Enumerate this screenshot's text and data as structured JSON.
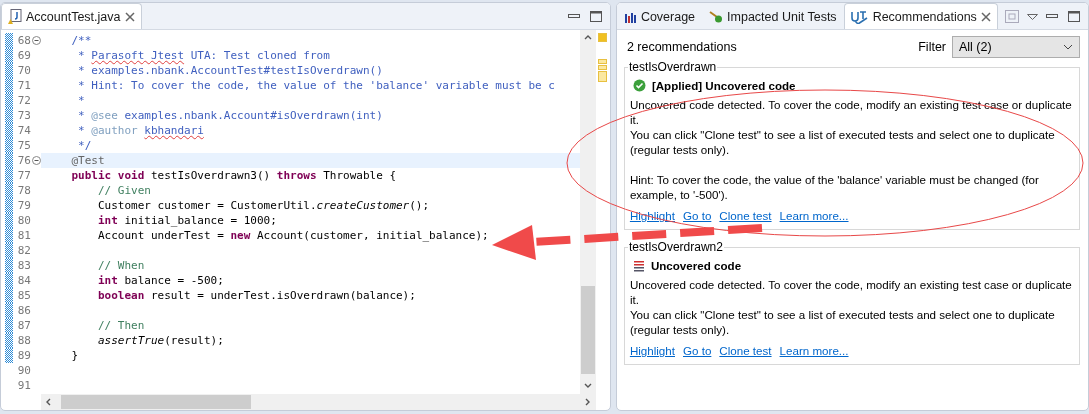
{
  "editor": {
    "tab": {
      "label": "AccountTest.java",
      "selected": true
    },
    "lines": [
      {
        "number": "68",
        "folding": true,
        "highlighted": false,
        "changed": true,
        "tokens": [
          {
            "kind": "javadoc",
            "text": "    /**"
          }
        ]
      },
      {
        "number": "69",
        "folding": false,
        "highlighted": false,
        "changed": true,
        "tokens": [
          {
            "kind": "javadoc",
            "text": "     * "
          },
          {
            "kind": "spelling",
            "text": "Parasoft Jtest"
          },
          {
            "kind": "javadoc",
            "text": " UTA: Test cloned from"
          }
        ]
      },
      {
        "number": "70",
        "folding": false,
        "highlighted": false,
        "changed": true,
        "tokens": [
          {
            "kind": "javadoc",
            "text": "     * examples.nbank.AccountTest#testIsOverdrawn()"
          }
        ]
      },
      {
        "number": "71",
        "folding": false,
        "highlighted": false,
        "changed": true,
        "tokens": [
          {
            "kind": "javadoc",
            "text": "     * Hint: To cover the code, the value of the 'balance' variable must be c"
          }
        ]
      },
      {
        "number": "72",
        "folding": false,
        "highlighted": false,
        "changed": true,
        "tokens": [
          {
            "kind": "javadoc",
            "text": "     *"
          }
        ]
      },
      {
        "number": "73",
        "folding": false,
        "highlighted": false,
        "changed": true,
        "tokens": [
          {
            "kind": "javadoc",
            "text": "     * "
          },
          {
            "kind": "tag",
            "text": "@see"
          },
          {
            "kind": "javadoc",
            "text": " examples.nbank.Account#isOverdrawn(int)"
          }
        ]
      },
      {
        "number": "74",
        "folding": false,
        "highlighted": false,
        "changed": true,
        "tokens": [
          {
            "kind": "javadoc",
            "text": "     * "
          },
          {
            "kind": "tag",
            "text": "@author "
          },
          {
            "kind": "spelling",
            "text": "kbhandari"
          }
        ]
      },
      {
        "number": "75",
        "folding": false,
        "highlighted": false,
        "changed": true,
        "tokens": [
          {
            "kind": "javadoc",
            "text": "     */"
          }
        ]
      },
      {
        "number": "76",
        "folding": true,
        "highlighted": true,
        "changed": true,
        "tokens": [
          {
            "kind": "annotation",
            "text": "    @Test"
          }
        ]
      },
      {
        "number": "77",
        "folding": false,
        "highlighted": false,
        "changed": true,
        "tokens": [
          {
            "kind": "keyword",
            "text": "    public void"
          },
          {
            "kind": "plain",
            "text": " testIsOverdrawn3() "
          },
          {
            "kind": "keyword",
            "text": "throws"
          },
          {
            "kind": "plain",
            "text": " Throwable {"
          }
        ]
      },
      {
        "number": "78",
        "folding": false,
        "highlighted": false,
        "changed": true,
        "tokens": [
          {
            "kind": "comment",
            "text": "        // Given"
          }
        ]
      },
      {
        "number": "79",
        "folding": false,
        "highlighted": false,
        "changed": true,
        "tokens": [
          {
            "kind": "plain",
            "text": "        Customer customer = CustomerUtil."
          },
          {
            "kind": "italic",
            "text": "createCustomer"
          },
          {
            "kind": "plain",
            "text": "();"
          }
        ]
      },
      {
        "number": "80",
        "folding": false,
        "highlighted": false,
        "changed": true,
        "tokens": [
          {
            "kind": "keyword",
            "text": "        int"
          },
          {
            "kind": "plain",
            "text": " initial_balance = 1000;"
          }
        ]
      },
      {
        "number": "81",
        "folding": false,
        "highlighted": false,
        "changed": true,
        "tokens": [
          {
            "kind": "plain",
            "text": "        Account underTest = "
          },
          {
            "kind": "keyword",
            "text": "new"
          },
          {
            "kind": "plain",
            "text": " Account(customer, initial_balance);"
          }
        ]
      },
      {
        "number": "82",
        "folding": false,
        "highlighted": false,
        "changed": true
      },
      {
        "number": "83",
        "folding": false,
        "highlighted": false,
        "changed": true,
        "tokens": [
          {
            "kind": "comment",
            "text": "        // When"
          }
        ]
      },
      {
        "number": "84",
        "folding": false,
        "highlighted": false,
        "changed": true,
        "tokens": [
          {
            "kind": "keyword",
            "text": "        int"
          },
          {
            "kind": "plain",
            "text": " balance = -500;"
          }
        ]
      },
      {
        "number": "85",
        "folding": false,
        "highlighted": false,
        "changed": true,
        "tokens": [
          {
            "kind": "keyword",
            "text": "        boolean"
          },
          {
            "kind": "plain",
            "text": " result = underTest.isOverdrawn(balance);"
          }
        ]
      },
      {
        "number": "86",
        "folding": false,
        "highlighted": false,
        "changed": true
      },
      {
        "number": "87",
        "folding": false,
        "highlighted": false,
        "changed": true,
        "tokens": [
          {
            "kind": "comment",
            "text": "        // Then"
          }
        ]
      },
      {
        "number": "88",
        "folding": false,
        "highlighted": false,
        "changed": true,
        "tokens": [
          {
            "kind": "italic",
            "text": "        assertTrue"
          },
          {
            "kind": "plain",
            "text": "(result);"
          }
        ]
      },
      {
        "number": "89",
        "folding": false,
        "highlighted": false,
        "changed": true,
        "tokens": [
          {
            "kind": "plain",
            "text": "    }"
          }
        ]
      },
      {
        "number": "90",
        "folding": false,
        "highlighted": false,
        "changed": false
      },
      {
        "number": "91",
        "folding": false,
        "highlighted": false,
        "changed": false
      }
    ]
  },
  "view": {
    "tabs": [
      {
        "label": "Coverage",
        "kind": "coverage",
        "selected": false
      },
      {
        "label": "Impacted Unit Tests",
        "kind": "impacted",
        "selected": false
      },
      {
        "label": "Recommendations",
        "kind": "uta",
        "selected": true
      }
    ],
    "count": "2 recommendations",
    "filter": {
      "label": "Filter",
      "value": "All (2)"
    },
    "groups": [
      {
        "name": "testIsOverdrawn",
        "applied": true,
        "title": "[Applied] Uncovered code",
        "paragraphs": [
          "Uncovered code detected. To cover the code, modify an existing test case or duplicate it.",
          "You can click \"Clone test\" to see a list of executed tests and select one to duplicate (regular tests only)."
        ],
        "hint": "Hint: To cover the code, the value of the 'balance' variable must be changed (for example, to '-500').",
        "links": [
          "Highlight",
          "Go to",
          "Clone test",
          "Learn more..."
        ]
      },
      {
        "name": "testIsOverdrawn2",
        "applied": false,
        "title": "Uncovered code",
        "paragraphs": [
          "Uncovered code detected. To cover the code, modify an existing test case or duplicate it.",
          "You can click \"Clone test\" to see a list of executed tests and select one to duplicate (regular tests only)."
        ],
        "links": [
          "Highlight",
          "Go to",
          "Clone test",
          "Learn more..."
        ]
      }
    ]
  }
}
